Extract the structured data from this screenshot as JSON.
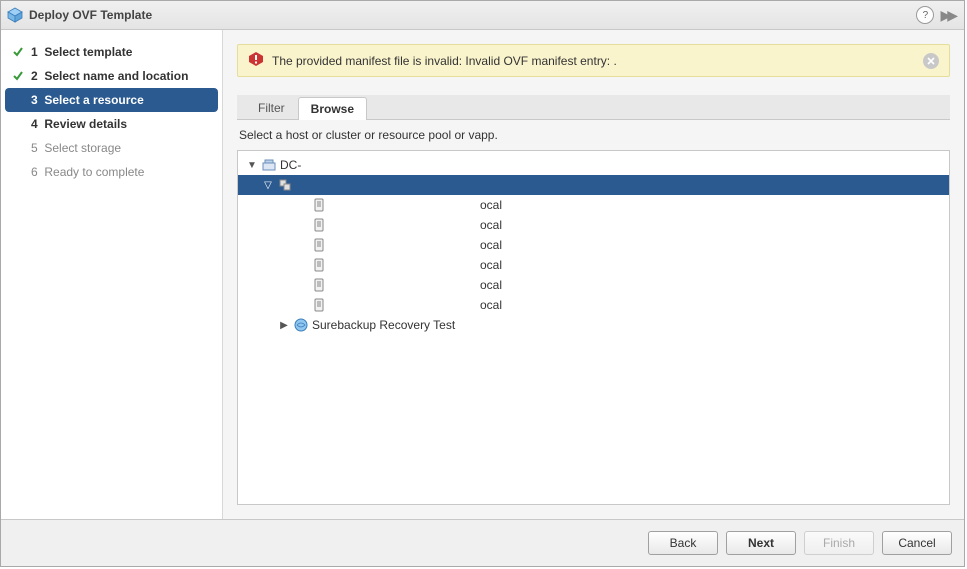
{
  "header": {
    "title": "Deploy OVF Template"
  },
  "steps": [
    {
      "num": "1",
      "label": "Select template",
      "state": "completed"
    },
    {
      "num": "2",
      "label": "Select name and location",
      "state": "completed"
    },
    {
      "num": "3",
      "label": "Select a resource",
      "state": "current"
    },
    {
      "num": "4",
      "label": "Review details",
      "state": "pending_bold"
    },
    {
      "num": "5",
      "label": "Select storage",
      "state": "pending"
    },
    {
      "num": "6",
      "label": "Ready to complete",
      "state": "pending"
    }
  ],
  "alert": {
    "message": "The provided manifest file is invalid: Invalid OVF manifest entry:                                                      ."
  },
  "tabs": {
    "filter": "Filter",
    "browse": "Browse"
  },
  "instruction": "Select a host or cluster or resource pool or vapp.",
  "tree": {
    "root_label": "DC-",
    "cluster_label": "",
    "hosts": [
      "ocal",
      "ocal",
      "ocal",
      "ocal",
      "ocal",
      "ocal"
    ],
    "vapp": "Surebackup Recovery Test"
  },
  "buttons": {
    "back": "Back",
    "next": "Next",
    "finish": "Finish",
    "cancel": "Cancel"
  }
}
